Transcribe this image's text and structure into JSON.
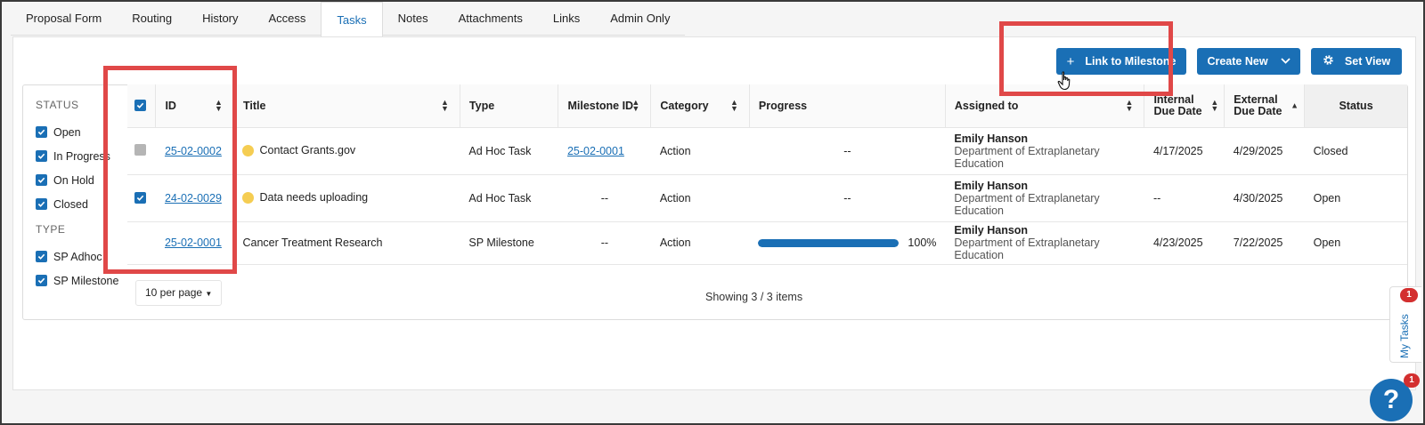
{
  "tabs": [
    {
      "label": "Proposal Form"
    },
    {
      "label": "Routing"
    },
    {
      "label": "History"
    },
    {
      "label": "Access"
    },
    {
      "label": "Tasks"
    },
    {
      "label": "Notes"
    },
    {
      "label": "Attachments"
    },
    {
      "label": "Links"
    },
    {
      "label": "Admin Only"
    }
  ],
  "active_tab": "Tasks",
  "toolbar": {
    "link_label": "Link to Milestone",
    "create_label": "Create New",
    "setview_label": "Set View"
  },
  "filters": {
    "status_heading": "STATUS",
    "status_items": [
      {
        "label": "Open",
        "checked": true
      },
      {
        "label": "In Progress",
        "checked": true
      },
      {
        "label": "On Hold",
        "checked": true
      },
      {
        "label": "Closed",
        "checked": true
      }
    ],
    "type_heading": "TYPE",
    "type_items": [
      {
        "label": "SP Adhoc",
        "checked": true
      },
      {
        "label": "SP Milestone",
        "checked": true
      }
    ]
  },
  "table": {
    "headers": {
      "id": "ID",
      "title": "Title",
      "type": "Type",
      "milestone": "Milestone ID",
      "category": "Category",
      "progress": "Progress",
      "assigned": "Assigned to",
      "internal_due_1": "Internal",
      "internal_due_2": "Due Date",
      "external_due_1": "External",
      "external_due_2": "Due Date",
      "status": "Status"
    },
    "rows": [
      {
        "id": "25-02-0002",
        "title": "Contact Grants.gov",
        "type": "Ad Hoc Task",
        "milestone": "25-02-0001",
        "category": "Action",
        "progress": "--",
        "assignee_name": "Emily Hanson",
        "assignee_dept": "Department of Extraplanetary Education",
        "internal_due": "4/17/2025",
        "external_due": "4/29/2025",
        "status": "Closed"
      },
      {
        "id": "24-02-0029",
        "title": "Data needs uploading",
        "type": "Ad Hoc Task",
        "milestone": "--",
        "category": "Action",
        "progress": "--",
        "assignee_name": "Emily Hanson",
        "assignee_dept": "Department of Extraplanetary Education",
        "internal_due": "--",
        "external_due": "4/30/2025",
        "status": "Open"
      },
      {
        "id": "25-02-0001",
        "title": "Cancer Treatment Research",
        "type": "SP Milestone",
        "milestone": "--",
        "category": "Action",
        "progress_value": 100,
        "progress_label": "100%",
        "assignee_name": "Emily Hanson",
        "assignee_dept": "Department of Extraplanetary Education",
        "internal_due": "4/23/2025",
        "external_due": "7/22/2025",
        "status": "Open"
      }
    ]
  },
  "pager": {
    "per_page": "10 per page",
    "showing": "Showing 3 / 3 items"
  },
  "side_widget": {
    "label": "My Tasks",
    "badge": "1"
  },
  "help": {
    "symbol": "?",
    "badge": "1"
  },
  "colors": {
    "accent": "#1a6fb5",
    "highlight": "#e04848",
    "badge": "#d32f2f",
    "pending_clock": "#f5cd52"
  }
}
